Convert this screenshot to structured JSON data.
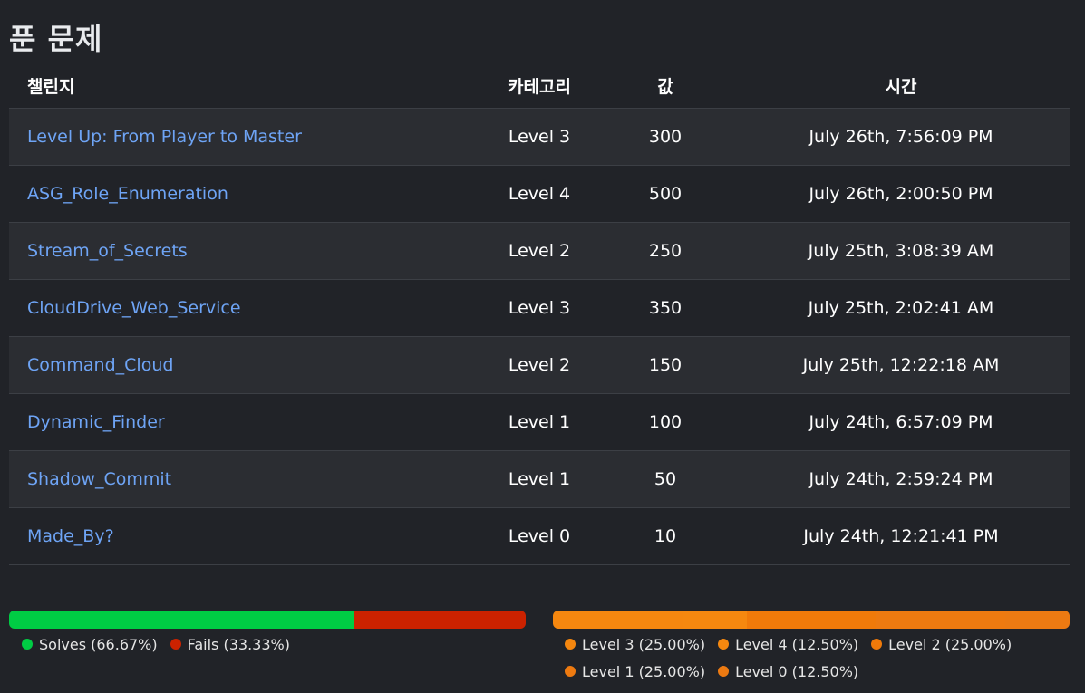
{
  "page_title": "푼 문제",
  "table": {
    "headers": {
      "challenge": "챌린지",
      "category": "카테고리",
      "value": "값",
      "time": "시간"
    },
    "rows": [
      {
        "name": "Level Up: From Player to Master",
        "category": "Level 3",
        "value": "300",
        "time": "July 26th, 7:56:09 PM"
      },
      {
        "name": "ASG_Role_Enumeration",
        "category": "Level 4",
        "value": "500",
        "time": "July 26th, 2:00:50 PM"
      },
      {
        "name": "Stream_of_Secrets",
        "category": "Level 2",
        "value": "250",
        "time": "July 25th, 3:08:39 AM"
      },
      {
        "name": "CloudDrive_Web_Service",
        "category": "Level 3",
        "value": "350",
        "time": "July 25th, 2:02:41 AM"
      },
      {
        "name": "Command_Cloud",
        "category": "Level 2",
        "value": "150",
        "time": "July 25th, 12:22:18 AM"
      },
      {
        "name": "Dynamic_Finder",
        "category": "Level 1",
        "value": "100",
        "time": "July 24th, 6:57:09 PM"
      },
      {
        "name": "Shadow_Commit",
        "category": "Level 1",
        "value": "50",
        "time": "July 24th, 2:59:24 PM"
      },
      {
        "name": "Made_By?",
        "category": "Level 0",
        "value": "10",
        "time": "July 24th, 12:21:41 PM"
      }
    ]
  },
  "solve_chart": {
    "segments": [
      {
        "label": "Solves (66.67%)",
        "percent": 66.67,
        "color": "#00cc44"
      },
      {
        "label": "Fails (33.33%)",
        "percent": 33.33,
        "color": "#cc2200"
      }
    ]
  },
  "category_chart": {
    "segments": [
      {
        "label": "Level 3 (25.00%)",
        "percent": 25.0,
        "color": "#f5870f"
      },
      {
        "label": "Level 4 (12.50%)",
        "percent": 12.5,
        "color": "#f5880f"
      },
      {
        "label": "Level 2 (25.00%)",
        "percent": 25.0,
        "color": "#f07a0a"
      },
      {
        "label": "Level 1 (25.00%)",
        "percent": 25.0,
        "color": "#ee7a10"
      },
      {
        "label": "Level 0 (12.50%)",
        "percent": 12.5,
        "color": "#ec7a12"
      }
    ]
  }
}
